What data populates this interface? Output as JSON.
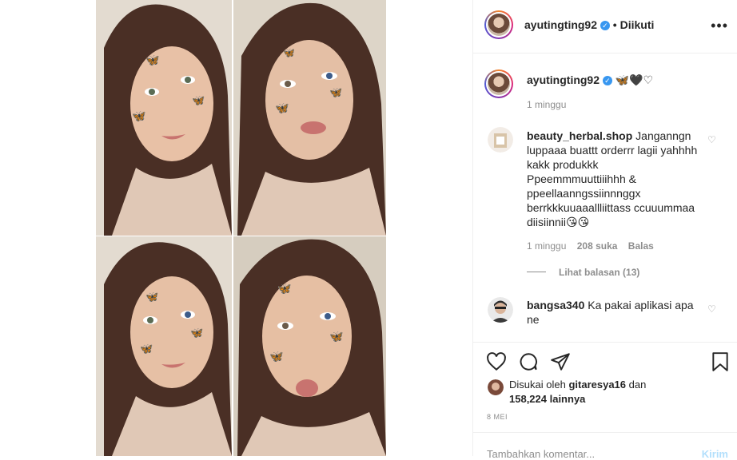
{
  "post": {
    "username": "ayutingting92",
    "follow_status": "• Diikuti",
    "more_label": "•••",
    "caption_emojis": "🦋🖤♡",
    "posted_time": "1 minggu",
    "likes_prefix": "Disukai oleh",
    "liked_by": "gitaresya16",
    "likes_suffix": "dan",
    "likes_count": "158,224 lainnya",
    "date": "8 MEI"
  },
  "comments": [
    {
      "username": "beauty_herbal.shop",
      "text": "Janganngn luppaaa buattt orderrr lagii yahhhh kakk produkkk Ppeemmmuuttiiihhh & ppeellaanngssiinnnggx berrkkkuuaaallliittass ccuuummaa diisiinnii😘😘",
      "time": "1 minggu",
      "likes": "208 suka",
      "reply": "Balas",
      "view_replies": "Lihat balasan (13)"
    },
    {
      "username": "bangsa340",
      "text": "Ka pakai aplikasi apa ne"
    }
  ],
  "footer": {
    "placeholder": "Tambahkan komentar...",
    "send_label": "Kirim"
  },
  "colors": {
    "verified": "#3897f0",
    "secondary_text": "#8e8e8e",
    "border": "#efefef"
  }
}
